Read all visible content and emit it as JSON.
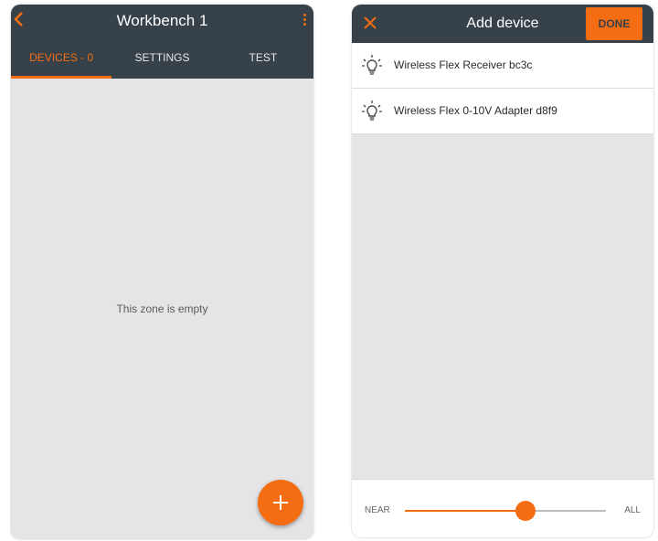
{
  "colors": {
    "accent": "#f46d12",
    "header": "#36414a",
    "background": "#e5e5e8"
  },
  "left_screen": {
    "title": "Workbench 1",
    "back_icon": "chevron-left-icon",
    "menu_icon": "more-vertical-icon",
    "tabs": [
      {
        "label": "DEVICES - 0",
        "active": true
      },
      {
        "label": "SETTINGS",
        "active": false
      },
      {
        "label": "TEST",
        "active": false
      }
    ],
    "empty_message": "This zone is empty",
    "fab_icon": "plus-icon"
  },
  "right_screen": {
    "title": "Add device",
    "close_icon": "close-icon",
    "done_label": "DONE",
    "devices": [
      {
        "icon": "lightbulb-icon",
        "label": "Wireless Flex Receiver bc3c"
      },
      {
        "icon": "lightbulb-icon",
        "label": "Wireless Flex 0-10V Adapter  d8f9"
      }
    ],
    "range": {
      "near_label": "NEAR",
      "all_label": "ALL",
      "value": 0.6
    }
  }
}
